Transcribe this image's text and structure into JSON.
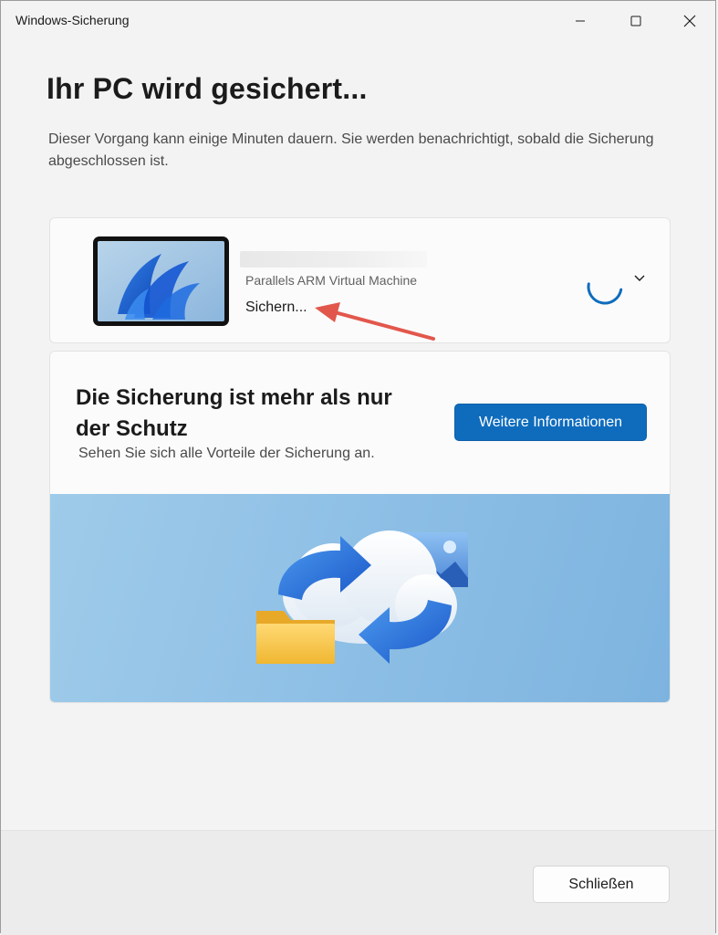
{
  "window": {
    "title": "Windows-Sicherung",
    "controls": [
      "minimize-icon",
      "maximize-icon",
      "close-icon"
    ]
  },
  "header": {
    "heading": "Ihr PC wird gesichert...",
    "description": "Dieser Vorgang kann einige Minuten dauern. Sie werden benachrichtigt, sobald die Sicherung abgeschlossen ist."
  },
  "device": {
    "model": "Parallels ARM Virtual Machine",
    "status": "Sichern...",
    "icons": [
      "spinner-icon",
      "chevron-down-icon"
    ]
  },
  "promo": {
    "title": "Die Sicherung ist mehr als nur der Schutz",
    "description": "Sehen Sie sich alle Vorteile der Sicherung an.",
    "button_label": "Weitere Informationen"
  },
  "footer": {
    "close_label": "Schließen"
  },
  "colors": {
    "accent": "#0f6cbd",
    "annotation_arrow": "#e2574c",
    "background": "#f3f3f3"
  }
}
